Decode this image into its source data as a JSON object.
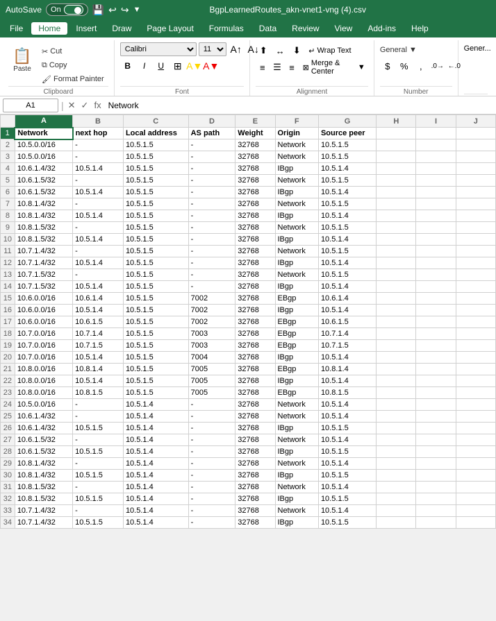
{
  "titleBar": {
    "autosave": "AutoSave",
    "autosaveState": "On",
    "filename": "BgpLearnedRoutes_akn-vnet1-vng (4).csv",
    "icons": [
      "save",
      "undo",
      "redo",
      "customize"
    ]
  },
  "menuBar": {
    "items": [
      "File",
      "Home",
      "Insert",
      "Draw",
      "Page Layout",
      "Formulas",
      "Data",
      "Review",
      "View",
      "Add-ins",
      "Help"
    ]
  },
  "ribbon": {
    "clipboard": {
      "label": "Clipboard",
      "paste_label": "Paste",
      "cut_label": "Cut",
      "copy_label": "Copy",
      "format_painter_label": "Format Painter"
    },
    "font": {
      "label": "Font",
      "font_name": "Calibri",
      "font_size": "11",
      "bold": "B",
      "italic": "I",
      "underline": "U"
    },
    "alignment": {
      "label": "Alignment",
      "wrap_text": "Wrap Text",
      "merge_center": "Merge & Center"
    },
    "number": {
      "label": "Number",
      "currency": "$"
    },
    "general_label": "Gener..."
  },
  "formulaBar": {
    "cellRef": "A1",
    "formula": "Network"
  },
  "columns": {
    "headers": [
      "",
      "A",
      "B",
      "C",
      "D",
      "E",
      "F",
      "G",
      "H",
      "I",
      "J"
    ],
    "labels": [
      "Network",
      "next hop",
      "Local address",
      "AS path",
      "Weight",
      "Origin",
      "Source peer",
      "",
      "",
      ""
    ]
  },
  "rows": [
    {
      "num": "1",
      "cells": [
        "Network",
        "next hop",
        "Local address",
        "AS path",
        "Weight",
        "Origin",
        "Source peer",
        "",
        "",
        ""
      ]
    },
    {
      "num": "2",
      "cells": [
        "10.5.0.0/16",
        "-",
        "10.5.1.5",
        "-",
        "32768",
        "Network",
        "10.5.1.5",
        "",
        "",
        ""
      ]
    },
    {
      "num": "3",
      "cells": [
        "10.5.0.0/16",
        "-",
        "10.5.1.5",
        "-",
        "32768",
        "Network",
        "10.5.1.5",
        "",
        "",
        ""
      ]
    },
    {
      "num": "4",
      "cells": [
        "10.6.1.4/32",
        "10.5.1.4",
        "10.5.1.5",
        "-",
        "32768",
        "IBgp",
        "10.5.1.4",
        "",
        "",
        ""
      ]
    },
    {
      "num": "5",
      "cells": [
        "10.6.1.5/32",
        "-",
        "10.5.1.5",
        "-",
        "32768",
        "Network",
        "10.5.1.5",
        "",
        "",
        ""
      ]
    },
    {
      "num": "6",
      "cells": [
        "10.6.1.5/32",
        "10.5.1.4",
        "10.5.1.5",
        "-",
        "32768",
        "IBgp",
        "10.5.1.4",
        "",
        "",
        ""
      ]
    },
    {
      "num": "7",
      "cells": [
        "10.8.1.4/32",
        "-",
        "10.5.1.5",
        "-",
        "32768",
        "Network",
        "10.5.1.5",
        "",
        "",
        ""
      ]
    },
    {
      "num": "8",
      "cells": [
        "10.8.1.4/32",
        "10.5.1.4",
        "10.5.1.5",
        "-",
        "32768",
        "IBgp",
        "10.5.1.4",
        "",
        "",
        ""
      ]
    },
    {
      "num": "9",
      "cells": [
        "10.8.1.5/32",
        "-",
        "10.5.1.5",
        "-",
        "32768",
        "Network",
        "10.5.1.5",
        "",
        "",
        ""
      ]
    },
    {
      "num": "10",
      "cells": [
        "10.8.1.5/32",
        "10.5.1.4",
        "10.5.1.5",
        "-",
        "32768",
        "IBgp",
        "10.5.1.4",
        "",
        "",
        ""
      ]
    },
    {
      "num": "11",
      "cells": [
        "10.7.1.4/32",
        "-",
        "10.5.1.5",
        "-",
        "32768",
        "Network",
        "10.5.1.5",
        "",
        "",
        ""
      ]
    },
    {
      "num": "12",
      "cells": [
        "10.7.1.4/32",
        "10.5.1.4",
        "10.5.1.5",
        "-",
        "32768",
        "IBgp",
        "10.5.1.4",
        "",
        "",
        ""
      ]
    },
    {
      "num": "13",
      "cells": [
        "10.7.1.5/32",
        "-",
        "10.5.1.5",
        "-",
        "32768",
        "Network",
        "10.5.1.5",
        "",
        "",
        ""
      ]
    },
    {
      "num": "14",
      "cells": [
        "10.7.1.5/32",
        "10.5.1.4",
        "10.5.1.5",
        "-",
        "32768",
        "IBgp",
        "10.5.1.4",
        "",
        "",
        ""
      ]
    },
    {
      "num": "15",
      "cells": [
        "10.6.0.0/16",
        "10.6.1.4",
        "10.5.1.5",
        "7002",
        "32768",
        "EBgp",
        "10.6.1.4",
        "",
        "",
        ""
      ]
    },
    {
      "num": "16",
      "cells": [
        "10.6.0.0/16",
        "10.5.1.4",
        "10.5.1.5",
        "7002",
        "32768",
        "IBgp",
        "10.5.1.4",
        "",
        "",
        ""
      ]
    },
    {
      "num": "17",
      "cells": [
        "10.6.0.0/16",
        "10.6.1.5",
        "10.5.1.5",
        "7002",
        "32768",
        "EBgp",
        "10.6.1.5",
        "",
        "",
        ""
      ]
    },
    {
      "num": "18",
      "cells": [
        "10.7.0.0/16",
        "10.7.1.4",
        "10.5.1.5",
        "7003",
        "32768",
        "EBgp",
        "10.7.1.4",
        "",
        "",
        ""
      ]
    },
    {
      "num": "19",
      "cells": [
        "10.7.0.0/16",
        "10.7.1.5",
        "10.5.1.5",
        "7003",
        "32768",
        "EBgp",
        "10.7.1.5",
        "",
        "",
        ""
      ]
    },
    {
      "num": "20",
      "cells": [
        "10.7.0.0/16",
        "10.5.1.4",
        "10.5.1.5",
        "7004",
        "32768",
        "IBgp",
        "10.5.1.4",
        "",
        "",
        ""
      ]
    },
    {
      "num": "21",
      "cells": [
        "10.8.0.0/16",
        "10.8.1.4",
        "10.5.1.5",
        "7005",
        "32768",
        "EBgp",
        "10.8.1.4",
        "",
        "",
        ""
      ]
    },
    {
      "num": "22",
      "cells": [
        "10.8.0.0/16",
        "10.5.1.4",
        "10.5.1.5",
        "7005",
        "32768",
        "IBgp",
        "10.5.1.4",
        "",
        "",
        ""
      ]
    },
    {
      "num": "23",
      "cells": [
        "10.8.0.0/16",
        "10.8.1.5",
        "10.5.1.5",
        "7005",
        "32768",
        "EBgp",
        "10.8.1.5",
        "",
        "",
        ""
      ]
    },
    {
      "num": "24",
      "cells": [
        "10.5.0.0/16",
        "-",
        "10.5.1.4",
        "-",
        "32768",
        "Network",
        "10.5.1.4",
        "",
        "",
        ""
      ]
    },
    {
      "num": "25",
      "cells": [
        "10.6.1.4/32",
        "-",
        "10.5.1.4",
        "-",
        "32768",
        "Network",
        "10.5.1.4",
        "",
        "",
        ""
      ]
    },
    {
      "num": "26",
      "cells": [
        "10.6.1.4/32",
        "10.5.1.5",
        "10.5.1.4",
        "-",
        "32768",
        "IBgp",
        "10.5.1.5",
        "",
        "",
        ""
      ]
    },
    {
      "num": "27",
      "cells": [
        "10.6.1.5/32",
        "-",
        "10.5.1.4",
        "-",
        "32768",
        "Network",
        "10.5.1.4",
        "",
        "",
        ""
      ]
    },
    {
      "num": "28",
      "cells": [
        "10.6.1.5/32",
        "10.5.1.5",
        "10.5.1.4",
        "-",
        "32768",
        "IBgp",
        "10.5.1.5",
        "",
        "",
        ""
      ]
    },
    {
      "num": "29",
      "cells": [
        "10.8.1.4/32",
        "-",
        "10.5.1.4",
        "-",
        "32768",
        "Network",
        "10.5.1.4",
        "",
        "",
        ""
      ]
    },
    {
      "num": "30",
      "cells": [
        "10.8.1.4/32",
        "10.5.1.5",
        "10.5.1.4",
        "-",
        "32768",
        "IBgp",
        "10.5.1.5",
        "",
        "",
        ""
      ]
    },
    {
      "num": "31",
      "cells": [
        "10.8.1.5/32",
        "-",
        "10.5.1.4",
        "-",
        "32768",
        "Network",
        "10.5.1.4",
        "",
        "",
        ""
      ]
    },
    {
      "num": "32",
      "cells": [
        "10.8.1.5/32",
        "10.5.1.5",
        "10.5.1.4",
        "-",
        "32768",
        "IBgp",
        "10.5.1.5",
        "",
        "",
        ""
      ]
    },
    {
      "num": "33",
      "cells": [
        "10.7.1.4/32",
        "-",
        "10.5.1.4",
        "-",
        "32768",
        "Network",
        "10.5.1.4",
        "",
        "",
        ""
      ]
    },
    {
      "num": "34",
      "cells": [
        "10.7.1.4/32",
        "10.5.1.5",
        "10.5.1.4",
        "-",
        "32768",
        "IBgp",
        "10.5.1.5",
        "",
        "",
        ""
      ]
    }
  ]
}
